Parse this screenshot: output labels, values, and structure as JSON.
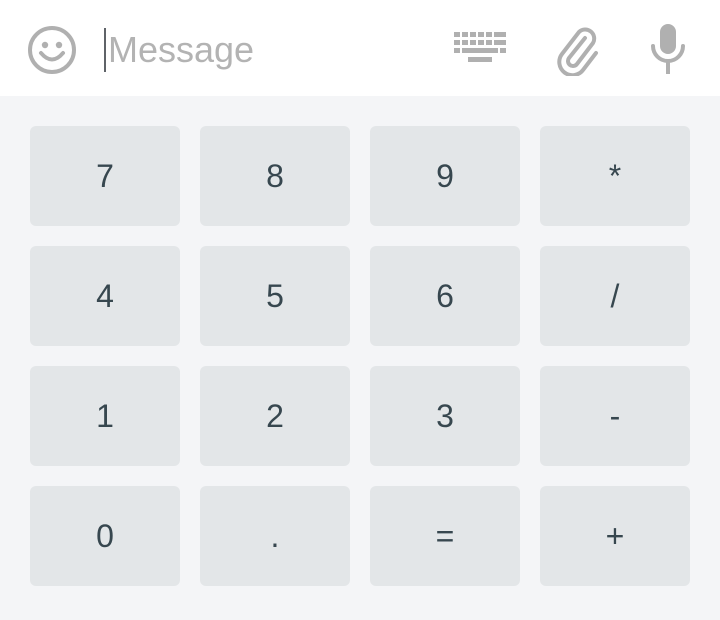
{
  "message_bar": {
    "placeholder": "Message",
    "value": "",
    "icons": {
      "emoji": "smiley-face-icon",
      "keyboard": "keyboard-icon",
      "attach": "paperclip-icon",
      "mic": "microphone-icon"
    }
  },
  "keypad": {
    "rows": [
      [
        "7",
        "8",
        "9",
        "*"
      ],
      [
        "4",
        "5",
        "6",
        "/"
      ],
      [
        "1",
        "2",
        "3",
        "-"
      ],
      [
        "0",
        ".",
        "=",
        "+"
      ]
    ]
  },
  "colors": {
    "icon_gray": "#b0b0b0",
    "key_bg": "#e3e6e8",
    "key_text": "#37474f",
    "keypad_bg": "#f4f5f7"
  }
}
